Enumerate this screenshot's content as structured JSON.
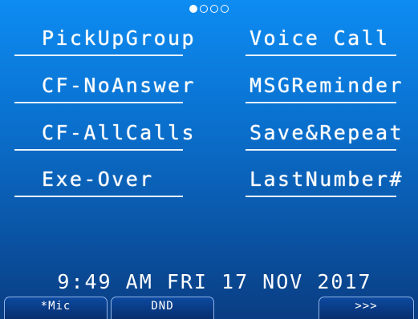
{
  "page_indicator": {
    "count": 4,
    "active_index": 0
  },
  "keys": {
    "left": [
      {
        "label": "PickUpGroup"
      },
      {
        "label": "CF-NoAnswer"
      },
      {
        "label": "CF-AllCalls"
      },
      {
        "label": "Exe-Over"
      }
    ],
    "right": [
      {
        "label": "Voice Call"
      },
      {
        "label": "MSGReminder"
      },
      {
        "label": "Save&Repeat"
      },
      {
        "label": "LastNumber#"
      }
    ]
  },
  "status": {
    "datetime": "9:49 AM FRI 17 NOV 2017"
  },
  "function_bar": {
    "f1": "*Mic",
    "f2": "DND",
    "f4": ">>>"
  },
  "colors": {
    "background_top": "#0d8cf2",
    "background_bottom": "#0a3d82",
    "text": "#ffffff"
  }
}
